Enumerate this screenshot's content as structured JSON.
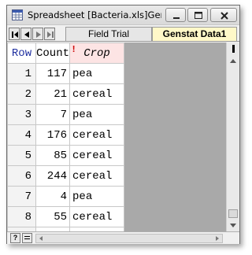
{
  "window": {
    "title": "Spreadsheet [Bacteria.xls]Gen...",
    "icon": "spreadsheet-icon"
  },
  "tabs": [
    {
      "label": "Field Trial",
      "active": false
    },
    {
      "label": "Genstat Data1",
      "active": true
    }
  ],
  "columns": {
    "row": "Row",
    "count": "Count",
    "crop": "Crop",
    "crop_factor_marker": "!"
  },
  "rows": [
    {
      "row": "1",
      "count": "117",
      "crop": "pea"
    },
    {
      "row": "2",
      "count": "21",
      "crop": "cereal"
    },
    {
      "row": "3",
      "count": "7",
      "crop": "pea"
    },
    {
      "row": "4",
      "count": "176",
      "crop": "cereal"
    },
    {
      "row": "5",
      "count": "85",
      "crop": "cereal"
    },
    {
      "row": "6",
      "count": "244",
      "crop": "cereal"
    },
    {
      "row": "7",
      "count": "4",
      "crop": "pea"
    },
    {
      "row": "8",
      "count": "55",
      "crop": "cereal"
    }
  ],
  "statusbar": {
    "help_label": "?"
  },
  "colors": {
    "active_tab_bg": "#fff8c8",
    "factor_header_bg": "#fde4e4",
    "row_header_text": "#2030a0",
    "grid_bg": "#a9a9a9"
  }
}
